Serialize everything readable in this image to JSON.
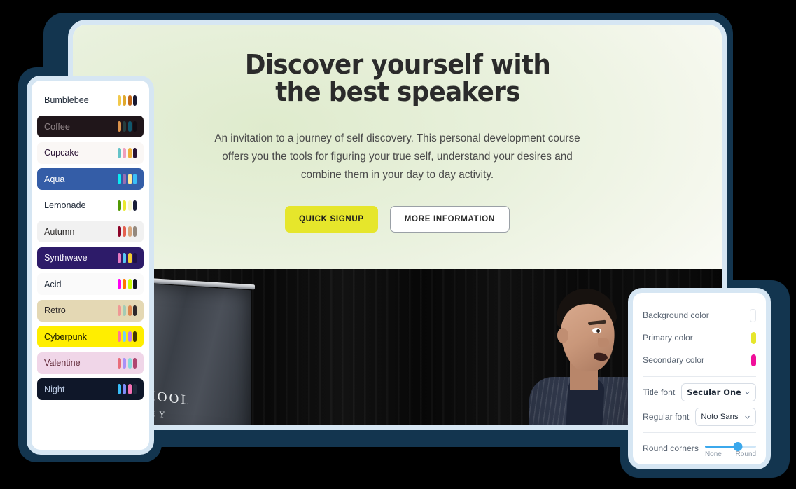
{
  "hero": {
    "title_line1": "Discover yourself with",
    "title_line2": "the best speakers",
    "paragraph": "An invitation to a journey of self discovery. This personal development course offers you the tools for figuring your true self, understand your desires and combine them in your day to day activity.",
    "primary_button": "QUICK SIGNUP",
    "secondary_button": "MORE INFORMATION",
    "primary_button_color": "#e6e62b",
    "photo": {
      "banner_name": "DUCT SCHOOL",
      "banner_sub": "ICON VALLEY"
    }
  },
  "themes": {
    "items": [
      {
        "name": "Bumblebee",
        "bg": "#ffffff",
        "text": "#1f2937",
        "swatches": [
          "#f2c94c",
          "#e0a82e",
          "#c2681a",
          "#181830"
        ]
      },
      {
        "name": "Coffee",
        "bg": "#20161a",
        "text": "#8d8184",
        "swatches": [
          "#db924b",
          "#263e3f",
          "#10576d",
          "#120c12"
        ]
      },
      {
        "name": "Cupcake",
        "bg": "#faf7f5",
        "text": "#291334",
        "swatches": [
          "#65c3c8",
          "#ef9fbc",
          "#eeaf3a",
          "#291334"
        ]
      },
      {
        "name": "Aqua",
        "bg": "#345da7",
        "text": "#ffffff",
        "swatches": [
          "#09ecf3",
          "#966fb3",
          "#ffe999",
          "#3abff8"
        ]
      },
      {
        "name": "Lemonade",
        "bg": "#ffffff",
        "text": "#1f2937",
        "swatches": [
          "#519903",
          "#e9e92f",
          "#f7f7c6",
          "#191e37"
        ]
      },
      {
        "name": "Autumn",
        "bg": "#f1f1f1",
        "text": "#32302f",
        "swatches": [
          "#8c0327",
          "#e4604f",
          "#d6a57c",
          "#94897e"
        ]
      },
      {
        "name": "Synthwave",
        "bg": "#2d1b69",
        "text": "#f9f7fd",
        "swatches": [
          "#e779c1",
          "#58c7f3",
          "#f3cc30",
          "#1f1048"
        ]
      },
      {
        "name": "Acid",
        "bg": "#fafafa",
        "text": "#1f2937",
        "swatches": [
          "#ff00f4",
          "#ff7400",
          "#cbfd03",
          "#151726"
        ]
      },
      {
        "name": "Retro",
        "bg": "#e4d8b4",
        "text": "#282425",
        "swatches": [
          "#ef9995",
          "#a4cbb4",
          "#dc8850",
          "#2e282a"
        ]
      },
      {
        "name": "Cyberpunk",
        "bg": "#ffee00",
        "text": "#1a1a00",
        "swatches": [
          "#ff7598",
          "#75d1f0",
          "#c07eec",
          "#423500"
        ]
      },
      {
        "name": "Valentine",
        "bg": "#f0d6e8",
        "text": "#632c3b",
        "swatches": [
          "#e96d7b",
          "#a991f7",
          "#88dbdd",
          "#af4670"
        ]
      },
      {
        "name": "Night",
        "bg": "#0f1729",
        "text": "#b8c7e0",
        "swatches": [
          "#38bdf8",
          "#818cf8",
          "#f471b5",
          "#1e293b"
        ]
      }
    ]
  },
  "settings": {
    "colors": [
      {
        "label": "Background color",
        "value": "#ffffff"
      },
      {
        "label": "Primary color",
        "value": "#e6e62b"
      },
      {
        "label": "Secondary color",
        "value": "#f00f9a"
      }
    ],
    "fonts": [
      {
        "label": "Title font",
        "value": "Secular One",
        "display": true
      },
      {
        "label": "Regular font",
        "value": "Noto Sans",
        "display": false
      }
    ],
    "round_corners": {
      "label": "Round corners",
      "min_label": "None",
      "max_label": "Round",
      "value_percent": 65,
      "accent": "#3ba8ec"
    }
  }
}
